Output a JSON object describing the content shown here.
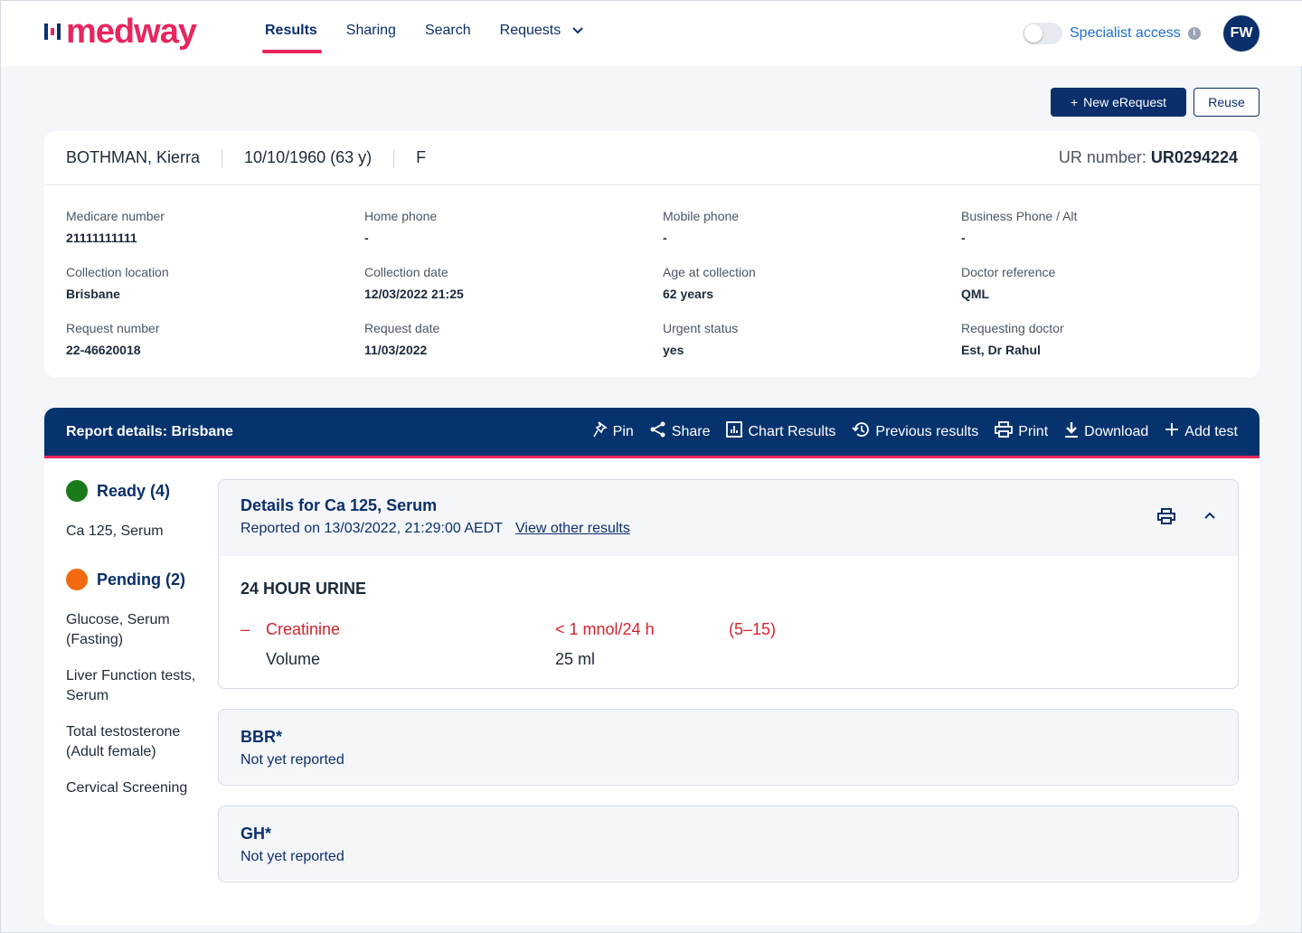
{
  "header": {
    "logo": "medway",
    "nav": [
      "Results",
      "Sharing",
      "Search",
      "Requests"
    ],
    "specialist_access": "Specialist access",
    "avatar": "FW"
  },
  "buttons": {
    "new_erequest": "New eRequest",
    "reuse": "Reuse"
  },
  "patient": {
    "name": "BOTHMAN, Kierra",
    "dob": "10/10/1960 (63 y)",
    "sex": "F",
    "ur_label": "UR number:",
    "ur_value": "UR0294224",
    "fields": [
      {
        "label": "Medicare number",
        "value": "21111111111"
      },
      {
        "label": "Home phone",
        "value": "-"
      },
      {
        "label": "Mobile phone",
        "value": "-"
      },
      {
        "label": "Business Phone / Alt",
        "value": "-"
      },
      {
        "label": "Collection location",
        "value": "Brisbane"
      },
      {
        "label": "Collection date",
        "value": "12/03/2022 21:25"
      },
      {
        "label": "Age at collection",
        "value": "62 years"
      },
      {
        "label": "Doctor reference",
        "value": "QML"
      },
      {
        "label": "Request number",
        "value": "22-46620018"
      },
      {
        "label": "Request date",
        "value": "11/03/2022"
      },
      {
        "label": "Urgent status",
        "value": "yes"
      },
      {
        "label": "Requesting doctor",
        "value": "Est, Dr Rahul"
      }
    ]
  },
  "report": {
    "title": "Report details: Brisbane",
    "actions": [
      "Pin",
      "Share",
      "Chart Results",
      "Previous results",
      "Print",
      "Download",
      "Add test"
    ],
    "ready_label": "Ready (4)",
    "ready_items": [
      "Ca 125, Serum"
    ],
    "pending_label": "Pending (2)",
    "pending_items": [
      "Glucose, Serum (Fasting)",
      "Liver Function tests, Serum",
      "Total testosterone (Adult female)",
      "Cervical Screening"
    ],
    "colors": {
      "ready": "#1a7a1a",
      "pending": "#f26a0f"
    },
    "detail": {
      "title": "Details for Ca 125, Serum",
      "reported": "Reported on 13/03/2022, 21:29:00 AEDT",
      "view_other": "View other results",
      "section": "24 HOUR URINE",
      "rows": [
        {
          "marker": "–",
          "name": "Creatinine",
          "value": "< 1 mnol/24 h",
          "range": "(5–15)",
          "abnormal": true
        },
        {
          "marker": "",
          "name": "Volume",
          "value": "25 ml",
          "range": "",
          "abnormal": false
        }
      ]
    },
    "pending_cards": [
      {
        "title": "BBR*",
        "status": "Not yet reported"
      },
      {
        "title": "GH*",
        "status": "Not yet reported"
      }
    ]
  }
}
